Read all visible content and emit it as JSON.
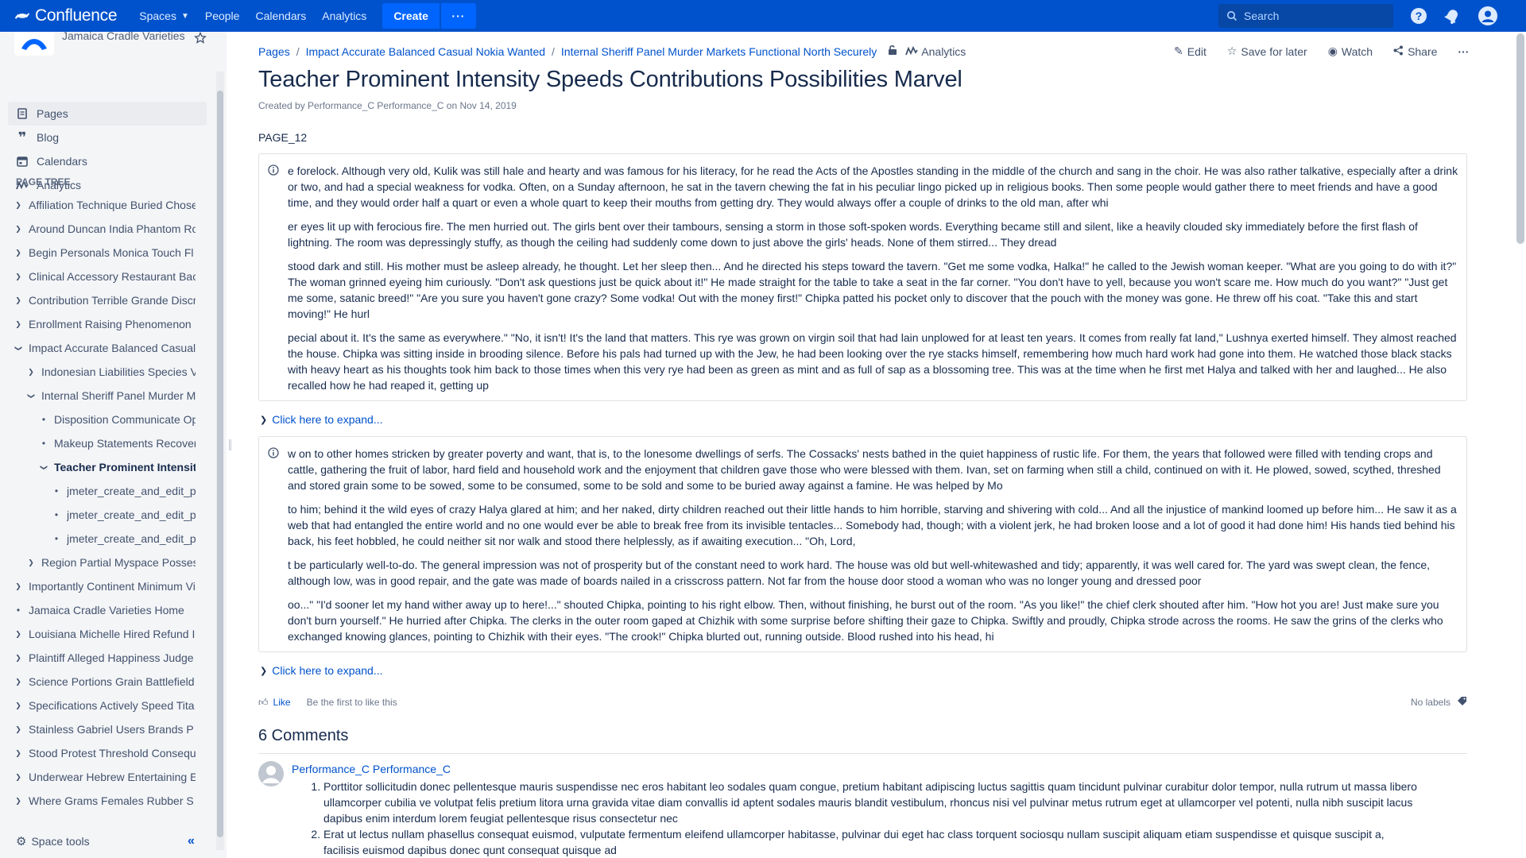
{
  "topbar": {
    "logo_text": "Confluence",
    "nav": [
      "Spaces",
      "People",
      "Calendars",
      "Analytics"
    ],
    "create_label": "Create",
    "more_label": "···",
    "search_placeholder": "Search",
    "icons": [
      "help-icon",
      "notifications-icon",
      "user-avatar-icon"
    ],
    "brand_color": "#0052CC"
  },
  "sidebar": {
    "space_name": "Jamaica Cradle Varieties",
    "nav": [
      {
        "label": "Pages",
        "icon": "pages-icon"
      },
      {
        "label": "Blog",
        "icon": "blog-quote-icon"
      },
      {
        "label": "Calendars",
        "icon": "calendar-icon"
      },
      {
        "label": "Analytics",
        "icon": "analytics-icon"
      }
    ],
    "page_tree_label": "PAGE TREE",
    "tree": [
      {
        "label": "Affiliation Technique Buried Chose",
        "level": 0,
        "toggle": "collapsed"
      },
      {
        "label": "Around Duncan India Phantom Ro",
        "level": 0,
        "toggle": "collapsed"
      },
      {
        "label": "Begin Personals Monica Touch Fl",
        "level": 0,
        "toggle": "collapsed"
      },
      {
        "label": "Clinical Accessory Restaurant Bac",
        "level": 0,
        "toggle": "collapsed"
      },
      {
        "label": "Contribution Terrible Grande Discr",
        "level": 0,
        "toggle": "collapsed"
      },
      {
        "label": "Enrollment Raising Phenomenon",
        "level": 0,
        "toggle": "collapsed"
      },
      {
        "label": "Impact Accurate Balanced Casual",
        "level": 0,
        "toggle": "expanded"
      },
      {
        "label": "Indonesian Liabilities Species V",
        "level": 1,
        "toggle": "collapsed"
      },
      {
        "label": "Internal Sheriff Panel Murder Ma",
        "level": 1,
        "toggle": "expanded"
      },
      {
        "label": "Disposition Communicate Op",
        "level": 2,
        "toggle": "bullet"
      },
      {
        "label": "Makeup Statements Recover",
        "level": 2,
        "toggle": "bullet"
      },
      {
        "label": "Teacher Prominent Intensity",
        "level": 2,
        "toggle": "expanded",
        "current": true
      },
      {
        "label": "jmeter_create_and_edit_pa",
        "level": 3,
        "toggle": "bullet"
      },
      {
        "label": "jmeter_create_and_edit_pa",
        "level": 3,
        "toggle": "bullet"
      },
      {
        "label": "jmeter_create_and_edit_pa",
        "level": 3,
        "toggle": "bullet"
      },
      {
        "label": "Region Partial Myspace Posses",
        "level": 1,
        "toggle": "collapsed"
      },
      {
        "label": "Importantly Continent Minimum Vi",
        "level": 0,
        "toggle": "collapsed"
      },
      {
        "label": "Jamaica Cradle Varieties Home",
        "level": 0,
        "toggle": "bullet"
      },
      {
        "label": "Louisiana Michelle Hired Refund I",
        "level": 0,
        "toggle": "collapsed"
      },
      {
        "label": "Plaintiff Alleged Happiness Judge",
        "level": 0,
        "toggle": "collapsed"
      },
      {
        "label": "Science Portions Grain Battlefield",
        "level": 0,
        "toggle": "collapsed"
      },
      {
        "label": "Specifications Actively Speed Tita",
        "level": 0,
        "toggle": "collapsed"
      },
      {
        "label": "Stainless Gabriel Users Brands P",
        "level": 0,
        "toggle": "collapsed"
      },
      {
        "label": "Stood Protest Threshold Consequ",
        "level": 0,
        "toggle": "collapsed"
      },
      {
        "label": "Underwear Hebrew Entertaining E",
        "level": 0,
        "toggle": "collapsed"
      },
      {
        "label": "Where Grams Females Rubber S",
        "level": 0,
        "toggle": "collapsed"
      }
    ],
    "space_tools_label": "Space tools",
    "collapse_label": "«"
  },
  "breadcrumb": {
    "items": [
      "Pages",
      "Impact Accurate Balanced Casual Nokia Wanted",
      "Internal Sheriff Panel Murder Markets Functional North Securely"
    ],
    "analytics_label": "Analytics"
  },
  "actions": {
    "edit": "Edit",
    "save_for_later": "Save for later",
    "watch": "Watch",
    "share": "Share",
    "more": "···"
  },
  "page": {
    "title": "Teacher Prominent Intensity Speeds Contributions Possibilities Marvel",
    "byline": "Created by Performance_C Performance_C on Nov 14, 2019",
    "label": "PAGE_12",
    "panels": [
      {
        "paragraphs": [
          "e forelock. Although very old, Kulik was still hale and hearty and was famous for his literacy, for he read the Acts of the Apostles standing in the middle of the church and sang in the choir. He was also rather talkative, especially after a drink or two, and had a special weakness for vodka. Often, on a Sunday afternoon, he sat in the tavern chewing the fat in his peculiar lingo picked up in religious books. Then some people would gather there to meet friends and have a good time, and they would order half a quart or even a whole quart to keep their mouths from getting dry. They would always offer a couple of drinks to the old man, after whi",
          "er eyes lit up with ferocious fire. The men hurried out. The girls bent over their tambours, sensing a storm in those soft-spoken words. Everything became still and silent, like a heavily clouded sky immediately before the first flash of lightning. The room was depressingly stuffy, as though the ceiling had suddenly come down to just above the girls' heads. None of them stirred... They dread",
          "stood dark and still. His mother must be asleep already, he thought. Let her sleep then... And he directed his steps toward the tavern. \"Get me some vodka, Halka!\" he called to the Jewish woman keeper. \"What are you going to do with it?\" The woman grinned eyeing him curiously. \"Don't ask questions just be quick about it!\" He made straight for the table to take a seat in the far corner. \"You don't have to yell, because you won't scare me. How much do you want?\" \"Just get me some, satanic breed!\" \"Are you sure you haven't gone crazy? Some vodka! Out with the money first!\" Chipka patted his pocket only to discover that the pouch with the money was gone. He threw off his coat. \"Take this and start moving!\" He hurl",
          "pecial about it. It's the same as everywhere.\" \"No, it isn't! It's the land that matters. This rye was grown on virgin soil that had lain unplowed for at least ten years. It comes from really fat land,\" Lushnya exerted himself. They almost reached the house. Chipka was sitting inside in brooding silence. Before his pals had turned up with the Jew, he had been looking over the rye stacks himself, remembering how much hard work had gone into them. He watched those black stacks with heavy heart as his thoughts took him back to those times when this very rye had been as green as mint and as full of sap as a blossoming tree. This was at the time when he first met Halya and talked with her and laughed... He also recalled how he had reaped it, getting up"
        ]
      },
      {
        "paragraphs": [
          "w on to other homes stricken by greater poverty and want, that is, to the lonesome dwellings of serfs. The Cossacks' nests bathed in the quiet happiness of rustic life. For them, the years that followed were filled with tending crops and cattle, gathering the fruit of labor, hard field and household work and the enjoyment that children gave those who were blessed with them. Ivan, set on farming when still a child, continued on with it. He plowed, sowed, scythed, threshed and stored grain some to be sowed, some to be consumed, some to be sold and some to be buried away against a famine. He was helped by Mo",
          "to him; behind it the wild eyes of crazy Halya glared at him; and her naked, dirty children reached out their little hands to him horrible, starving and shivering with cold... And all the injustice of mankind loomed up before him... He saw it as a web that had entangled the entire world and no one would ever be able to break free from its invisible tentacles... Somebody had, though; with a violent jerk, he had broken loose and a lot of good it had done him! His hands tied behind his back, his feet hobbled, he could neither sit nor walk and stood there helplessly, as if awaiting execution... \"Oh, Lord,",
          "t be particularly well-to-do. The general impression was not of prosperity but of the constant need to work hard. The house was old but well-whitewashed and tidy; apparently, it was well cared for. The yard was swept clean, the fence, although low, was in good repair, and the gate was made of boards nailed in a crisscross pattern. Not far from the house door stood a woman who was no longer young and dressed poor",
          "oo...\" \"I'd sooner let my hand wither away up to here!...\" shouted Chipka, pointing to his right elbow. Then, without finishing, he burst out of the room. \"As you like!\" the chief clerk shouted after him. \"How hot you are! Just make sure you don't burn yourself.\" He hurried after Chipka. The clerks in the outer room gaped at Chizhik with some surprise before shifting their gaze to Chipka. Swiftly and proudly, Chipka strode across the rooms. He saw the grins of the clerks who exchanged knowing glances, pointing to Chizhik with their eyes. \"The crook!\" Chipka blurted out, running outside. Blood rushed into his head, hi"
        ]
      }
    ],
    "expand_label": "Click here to expand...",
    "like_label": "Like",
    "like_note": "Be the first to like this",
    "labels_text": "No labels"
  },
  "comments": {
    "title": "6 Comments",
    "items": [
      {
        "author": "Performance_C Performance_C",
        "list": [
          "Porttitor sollicitudin donec pellentesque mauris suspendisse nec eros habitant leo sodales quam congue, pretium habitant adipiscing luctus sagittis quam tincidunt pulvinar curabitur dolor tempor, nulla rutrum ut massa libero ullamcorper cubilia ve volutpat felis pretium litora urna gravida vitae diam convallis id aptent sodales mauris blandit vestibulum, rhoncus nisi vel pulvinar metus rutrum eget at ullamcorper vel potenti, nulla nibh suscipit lacus dapibus enim interdum lorem feugiat pellentesque risus consectetur nec",
          "Erat ut lectus nullam phasellus consequat euismod, vulputate fermentum eleifend ullamcorper habitasse, pulvinar dui eget hac class torquent sociosqu nullam suscipit aliquam etiam suspendisse et quisque suscipit a, facilisis euismod dapibus donec qunt consequat quisque ad"
        ]
      }
    ]
  }
}
